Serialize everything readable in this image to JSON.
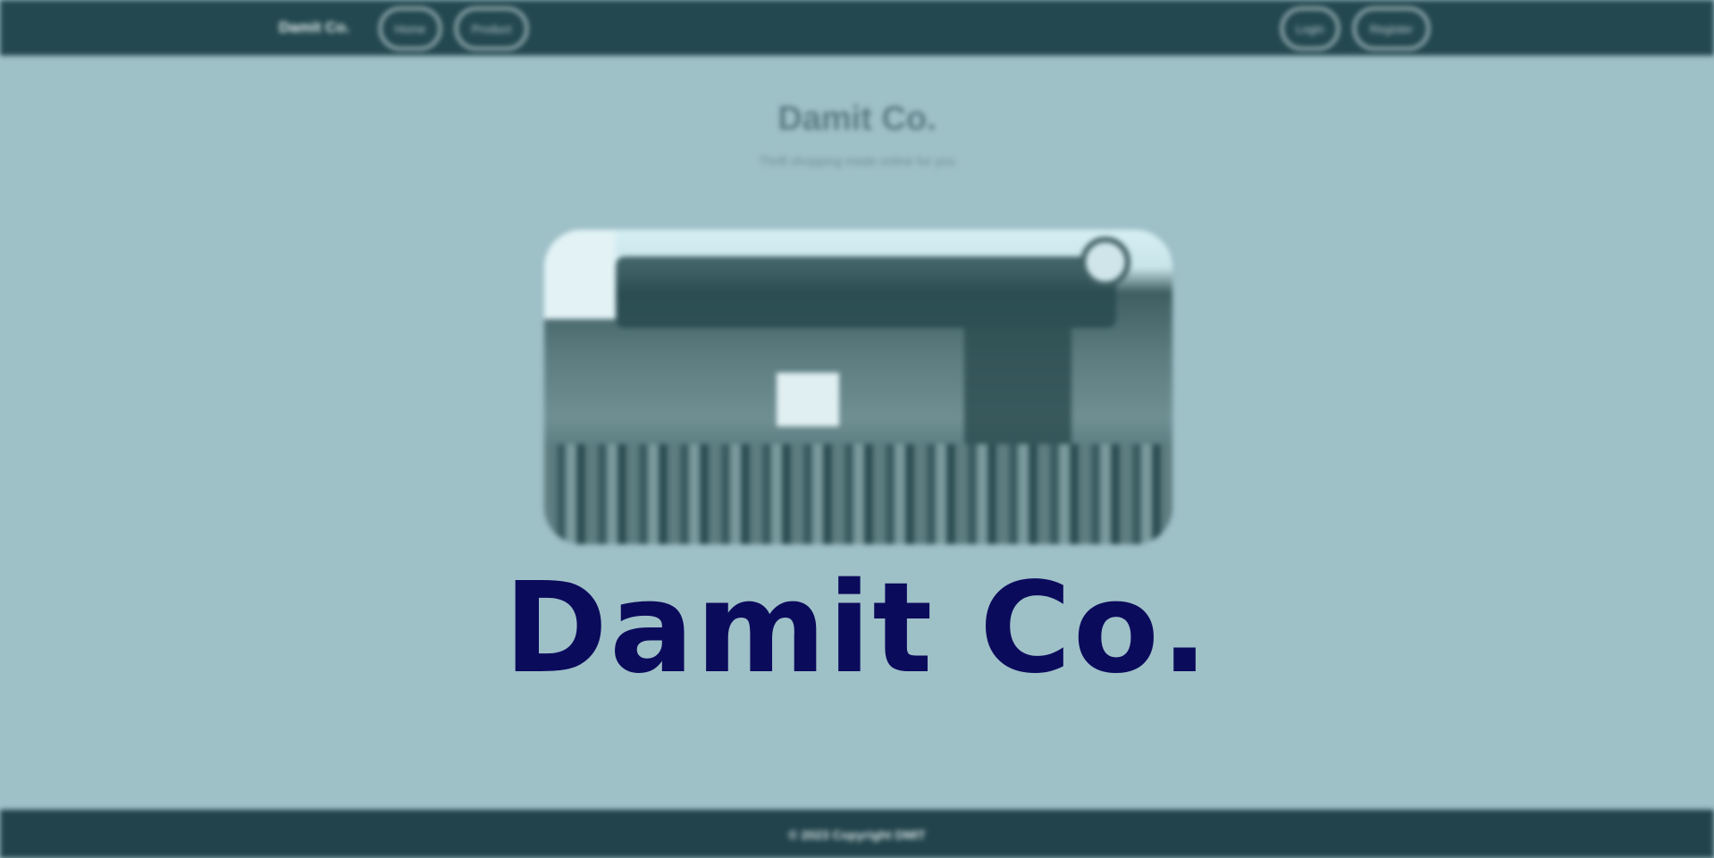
{
  "navbar": {
    "brand": "Damit Co.",
    "links": [
      "Home",
      "Product"
    ],
    "auth": [
      "Login",
      "Register"
    ]
  },
  "hero": {
    "title": "Damit Co.",
    "subtitle": "Thrift shopping made online for you"
  },
  "overlay": {
    "title": "Damit Co."
  },
  "footer": {
    "copyright": "© 2023 Copyright DMIT"
  },
  "colors": {
    "navbar": "#23484f",
    "background": "#9ec0c7",
    "overlay_text": "#0b0b5c",
    "footer": "#22434b"
  }
}
